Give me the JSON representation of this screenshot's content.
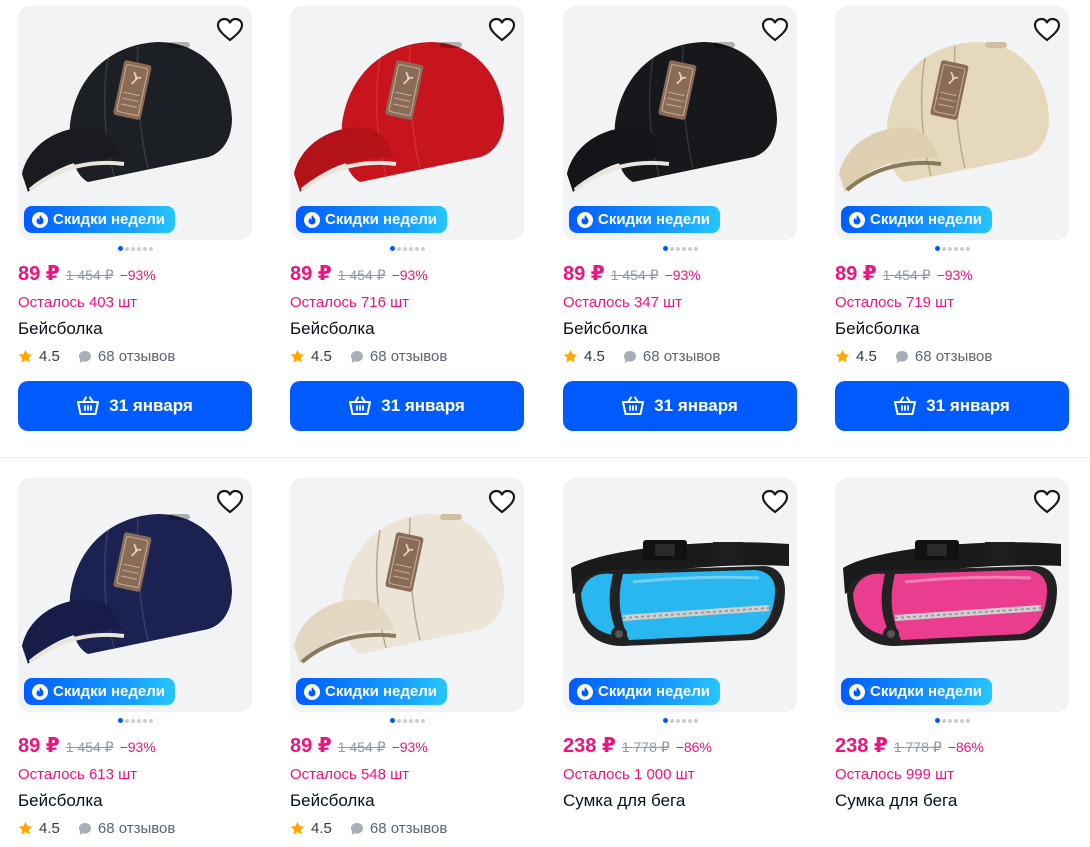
{
  "products": [
    {
      "badge": "Скидки недели",
      "price": "89 ₽",
      "old_price": "1 454 ₽",
      "discount": "−93%",
      "stock": "Осталось 403 шт",
      "name": "Бейсболка",
      "rating": "4.5",
      "reviews": "68 отзывов",
      "button": "31 января",
      "color": "#1c1f24"
    },
    {
      "badge": "Скидки недели",
      "price": "89 ₽",
      "old_price": "1 454 ₽",
      "discount": "−93%",
      "stock": "Осталось 716 шт",
      "name": "Бейсболка",
      "rating": "4.5",
      "reviews": "68 отзывов",
      "button": "31 января",
      "color": "#c8141c"
    },
    {
      "badge": "Скидки недели",
      "price": "89 ₽",
      "old_price": "1 454 ₽",
      "discount": "−93%",
      "stock": "Осталось 347 шт",
      "name": "Бейсболка",
      "rating": "4.5",
      "reviews": "68 отзывов",
      "button": "31 января",
      "color": "#16181c"
    },
    {
      "badge": "Скидки недели",
      "price": "89 ₽",
      "old_price": "1 454 ₽",
      "discount": "−93%",
      "stock": "Осталось 719 шт",
      "name": "Бейсболка",
      "rating": "4.5",
      "reviews": "68 отзывов",
      "button": "31 января",
      "color": "#e6d8bb"
    },
    {
      "badge": "Скидки недели",
      "price": "89 ₽",
      "old_price": "1 454 ₽",
      "discount": "−93%",
      "stock": "Осталось 613 шт",
      "name": "Бейсболка",
      "rating": "4.5",
      "reviews": "68 отзывов",
      "color": "#1b2150"
    },
    {
      "badge": "Скидки недели",
      "price": "89 ₽",
      "old_price": "1 454 ₽",
      "discount": "−93%",
      "stock": "Осталось 548 шт",
      "name": "Бейсболка",
      "rating": "4.5",
      "reviews": "68 отзывов",
      "color": "#ece4d6"
    },
    {
      "badge": "Скидки недели",
      "price": "238 ₽",
      "old_price": "1 778 ₽",
      "discount": "−86%",
      "stock": "Осталось 1 000 шт",
      "name": "Сумка для бега",
      "color": "#29b7ef"
    },
    {
      "badge": "Скидки недели",
      "price": "238 ₽",
      "old_price": "1 778 ₽",
      "discount": "−86%",
      "stock": "Осталось 999 шт",
      "name": "Сумка для бега",
      "color": "#ea3d8f"
    }
  ],
  "colors": {
    "accent": "#005bff",
    "price": "#f1117e",
    "muted": "#8e98a6"
  },
  "icons": {
    "favorite": "heart-outline-icon",
    "badge": "fire-icon",
    "rating": "star-icon",
    "reviews": "chat-bubble-icon",
    "cart": "basket-icon"
  }
}
